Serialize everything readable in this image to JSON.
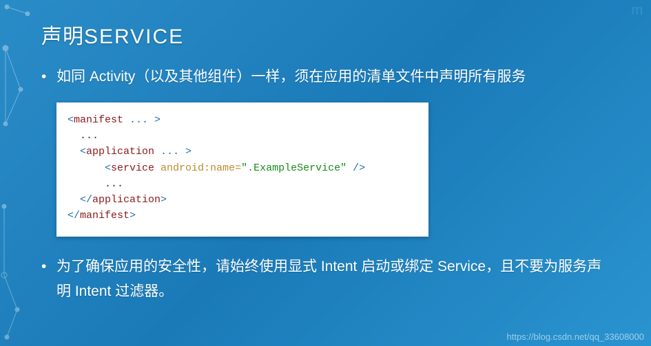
{
  "title": {
    "cn": "声明",
    "latin": "SERVICE"
  },
  "bullets": [
    "如同 Activity（以及其他组件）一样，须在应用的清单文件中声明所有服务",
    "为了确保应用的安全性，请始终使用显式 Intent 启动或绑定 Service，且不要为服务声明 Intent 过滤器。"
  ],
  "code": {
    "l1a": "<",
    "l1tag": "manifest",
    "l1b": " ... >",
    "l2": "  ...",
    "l3a": "  <",
    "l3tag": "application",
    "l3b": " ... >",
    "l4a": "      <",
    "l4tag": "service",
    "l4sp": " ",
    "l4attr": "android:name=",
    "l4str": "\".ExampleService\"",
    "l4end": " />",
    "l5": "      ...",
    "l6a": "  </",
    "l6tag": "application",
    "l6b": ">",
    "l7a": "</",
    "l7tag": "manifest",
    "l7b": ">"
  },
  "watermark": "https://blog.csdn.net/qq_33608000",
  "corner": "m"
}
